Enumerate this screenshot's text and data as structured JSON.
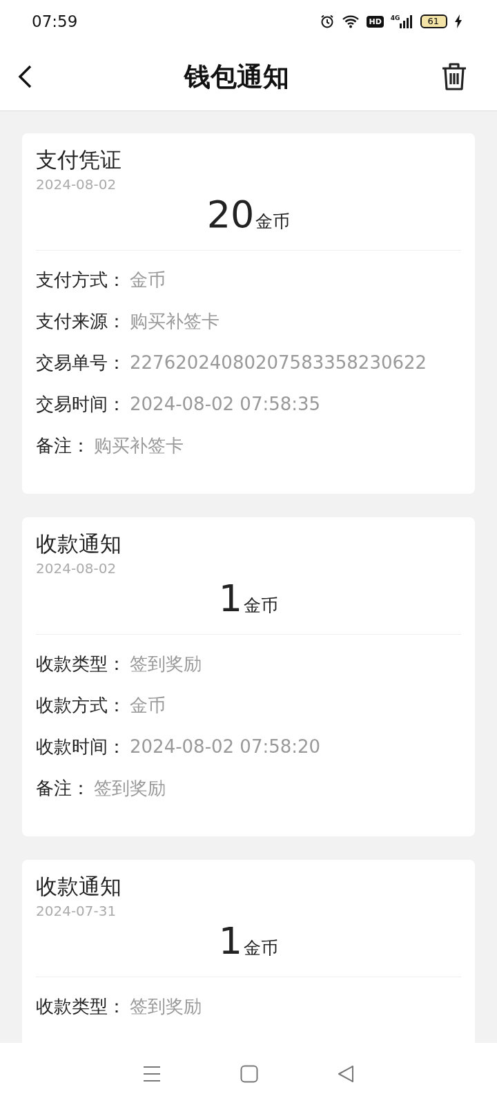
{
  "status_bar": {
    "time": "07:59",
    "hd": "HD",
    "network": "4G",
    "battery": "61"
  },
  "header": {
    "title": "钱包通知"
  },
  "cards": [
    {
      "title": "支付凭证",
      "date": "2024-08-02",
      "amount": "20",
      "unit": "金币",
      "rows": [
        {
          "label": "支付方式：",
          "value": "金币"
        },
        {
          "label": "支付来源：",
          "value": "购买补签卡"
        },
        {
          "label": "交易单号：",
          "value": "22762024080207583358230622"
        },
        {
          "label": "交易时间：",
          "value": "2024-08-02 07:58:35"
        },
        {
          "label": "备注：",
          "value": "购买补签卡"
        }
      ]
    },
    {
      "title": "收款通知",
      "date": "2024-08-02",
      "amount": "1",
      "unit": "金币",
      "rows": [
        {
          "label": "收款类型：",
          "value": "签到奖励"
        },
        {
          "label": "收款方式：",
          "value": "金币"
        },
        {
          "label": "收款时间：",
          "value": "2024-08-02 07:58:20"
        },
        {
          "label": "备注：",
          "value": "签到奖励"
        }
      ]
    },
    {
      "title": "收款通知",
      "date": "2024-07-31",
      "amount": "1",
      "unit": "金币",
      "rows": [
        {
          "label": "收款类型：",
          "value": "签到奖励"
        }
      ]
    }
  ]
}
